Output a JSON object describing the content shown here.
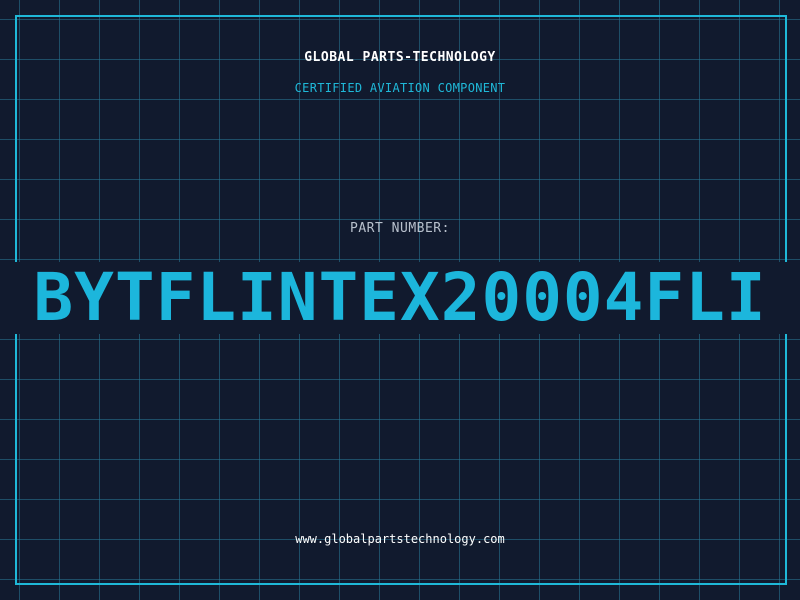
{
  "header": {
    "company": "GLOBAL PARTS-TECHNOLOGY",
    "subtitle": "CERTIFIED AVIATION COMPONENT"
  },
  "part": {
    "label": "PART NUMBER:",
    "number": "BYTFLINTEX20004FLI"
  },
  "footer": {
    "website": "www.globalpartstechnology.com"
  },
  "colors": {
    "background": "#111a2e",
    "accent": "#1fb8d8",
    "grid": "#28788f",
    "text": "#ffffff"
  }
}
